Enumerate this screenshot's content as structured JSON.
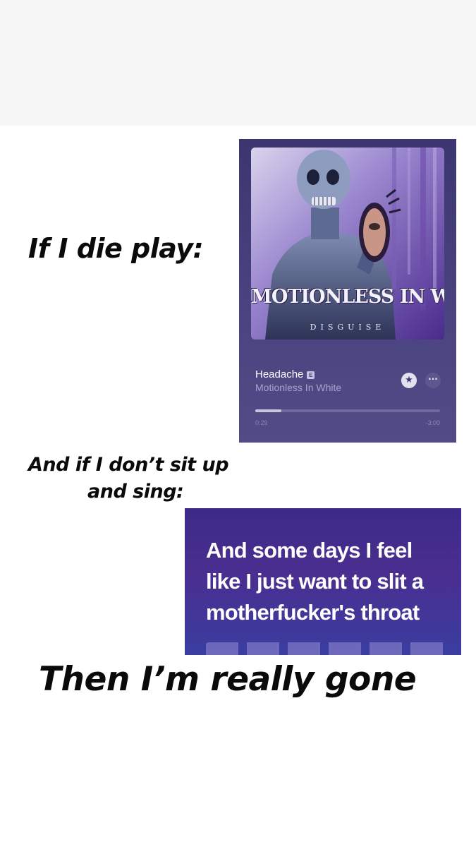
{
  "captions": {
    "if_i_die": "If I die play:",
    "sit_up_line1": "And if I don’t sit up",
    "sit_up_line2": "and sing:",
    "really_gone": "Then I’m really gone"
  },
  "player": {
    "cover": {
      "band_name": "MOTIONLESS IN WHITE",
      "album_title": "DISGUISE"
    },
    "song_title": "Headache",
    "explicit_badge": "E",
    "artist": "Motionless In White",
    "star_icon": "star-icon",
    "more_icon": "ellipsis-icon",
    "more_glyph": "···",
    "progress_fraction": 0.14,
    "time_elapsed": "0:29",
    "time_remaining": "-3:00"
  },
  "lyrics": {
    "lines": [
      "And some days I feel",
      "like I just want to slit a",
      "motherfucker's throat"
    ]
  },
  "colors": {
    "player_bg": "#3b3570",
    "lyrics_bg": "#4a2e90",
    "accent_text": "#a9a3cf"
  }
}
